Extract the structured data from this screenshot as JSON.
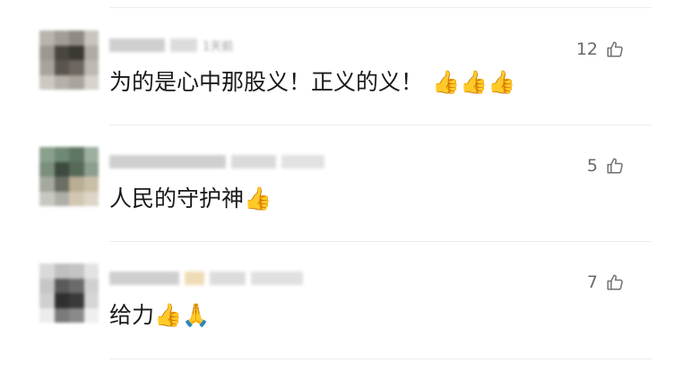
{
  "comments": [
    {
      "author": "",
      "meta": "1天前",
      "text": "为的是心中那股义！正义的义！",
      "emojis": [
        "👍",
        "👍",
        "👍"
      ],
      "likes": "12"
    },
    {
      "author": "",
      "meta": "",
      "text": "人民的守护神",
      "emojis": [
        "👍"
      ],
      "likes": "5"
    },
    {
      "author": "",
      "meta": "",
      "text": "给力",
      "emojis": [
        "👍",
        "🙏"
      ],
      "likes": "7"
    }
  ],
  "icons": {
    "like": "thumbs-up-outline-icon"
  },
  "colors": {
    "divider": "#ececec",
    "like_count": "#6a6a6a",
    "text": "#1a1a1a"
  }
}
